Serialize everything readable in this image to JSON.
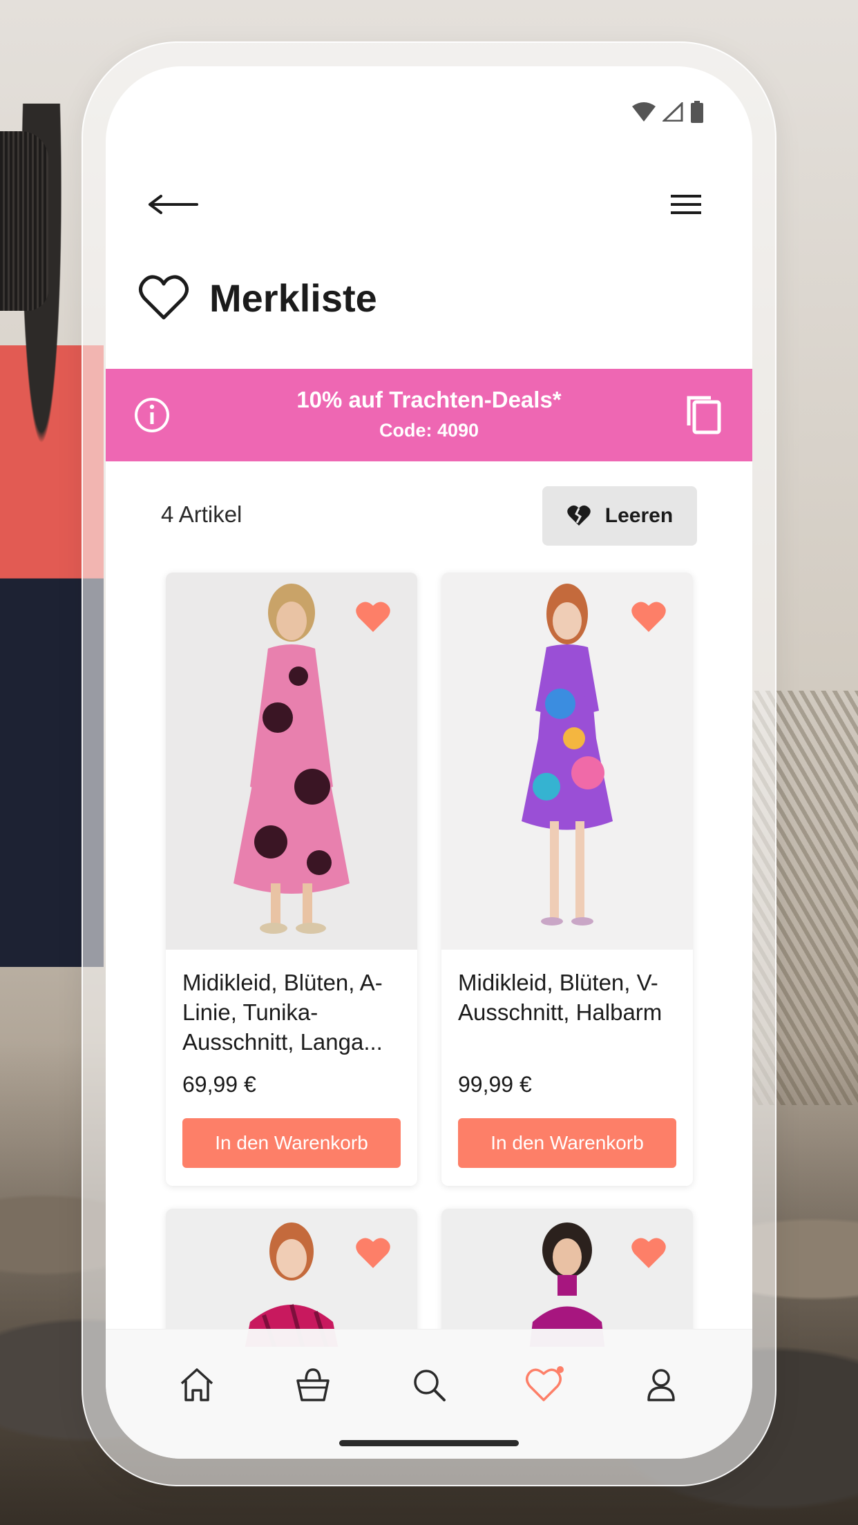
{
  "header": {
    "back_icon": "arrow-left-icon",
    "menu_icon": "hamburger-menu-icon"
  },
  "page": {
    "title": "Merkliste",
    "title_icon": "heart-outline-icon"
  },
  "promo": {
    "title": "10% auf Trachten-Deals*",
    "code": "Code: 4090",
    "background": "#ee67b3",
    "info_icon": "info-icon",
    "copy_icon": "copy-icon"
  },
  "list": {
    "count": "4 Artikel",
    "clear_label": "Leeren",
    "clear_icon": "broken-heart-icon"
  },
  "products": [
    {
      "title": "Midikleid, Blüten, A-Linie, Tunika-Ausschnitt, Langa...",
      "price": "69,99 €",
      "cart_label": "In den Warenkorb",
      "dress_color": "#e880ae"
    },
    {
      "title": "Midikleid, Blüten, V-Ausschnitt, Halbarm",
      "price": "99,99 €",
      "cart_label": "In den Warenkorb",
      "dress_color": "#9a4fd6"
    },
    {
      "dress_color": "#c8195e"
    },
    {
      "dress_color": "#a7167f"
    }
  ],
  "tabbar": {
    "tabs": [
      "home-icon",
      "shopping-bag-icon",
      "search-icon",
      "heart-icon",
      "user-icon"
    ],
    "active": "heart-icon"
  },
  "colors": {
    "accent": "#fd7f68",
    "promo": "#ee67b3",
    "favorite": "#fd7f68"
  }
}
